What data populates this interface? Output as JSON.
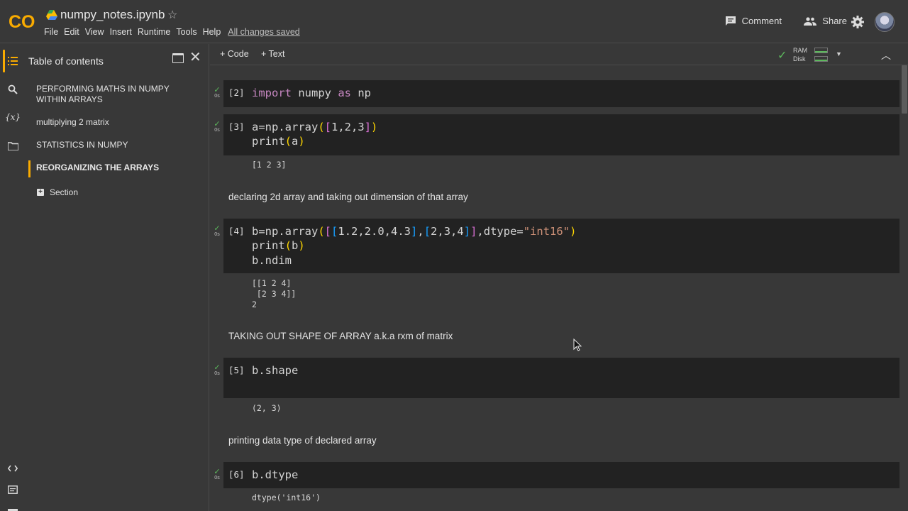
{
  "app": {
    "logo_text": "CO",
    "title": "numpy_notes.ipynb",
    "menu": [
      "File",
      "Edit",
      "View",
      "Insert",
      "Runtime",
      "Tools",
      "Help"
    ],
    "saved_status": "All changes saved",
    "comment_label": "Comment",
    "share_label": "Share"
  },
  "toc": {
    "title": "Table of contents",
    "items": [
      {
        "label": "PERFORMING MATHS IN NUMPY WITHIN ARRAYS"
      },
      {
        "label": "multiplying 2 matrix"
      },
      {
        "label": "STATISTICS IN NUMPY"
      },
      {
        "label": "REORGANIZING THE ARRAYS"
      }
    ],
    "section_label": "Section"
  },
  "toolbar": {
    "code_label": "+ Code",
    "text_label": "+ Text",
    "ram_label": "RAM",
    "disk_label": "Disk"
  },
  "cells": [
    {
      "exec": "[2]",
      "time": "0s"
    },
    {
      "exec": "[3]",
      "time": "0s",
      "output": "[1 2 3]"
    },
    {
      "exec": "[4]",
      "time": "0s",
      "output": "[[1 2 4]\n [2 3 4]]\n2"
    },
    {
      "exec": "[5]",
      "time": "0s",
      "output": "(2, 3)"
    },
    {
      "exec": "[6]",
      "time": "0s",
      "output": "dtype('int16')"
    }
  ],
  "markdown": [
    "declaring 2d array and taking out dimension of that array",
    "TAKING OUT SHAPE OF ARRAY a.k.a rxm of matrix",
    "printing data type of declared array"
  ],
  "code": {
    "c2": {
      "kw1": "import",
      "mod": " numpy ",
      "kw2": "as",
      "alias": " np"
    },
    "c3": {
      "l1a": "a=np.array",
      "l1b": "1,2,3",
      "l2a": "print",
      "l2b": "a"
    },
    "c4": {
      "l1a": "b=np.array",
      "n1": "1.2,2.0,4.3",
      "n2": "2,3,4",
      "l1c": ",dtype=",
      "s": "\"int16\"",
      "l2a": "print",
      "l2b": "b",
      "l3": "b.ndim"
    },
    "c5": {
      "l1": "b.shape"
    },
    "c6": {
      "l1": "b.dtype"
    }
  },
  "colors": {
    "accent": "#f9ab00",
    "success": "#5cb85c",
    "cell_bg": "#222222",
    "page_bg": "#383838"
  }
}
